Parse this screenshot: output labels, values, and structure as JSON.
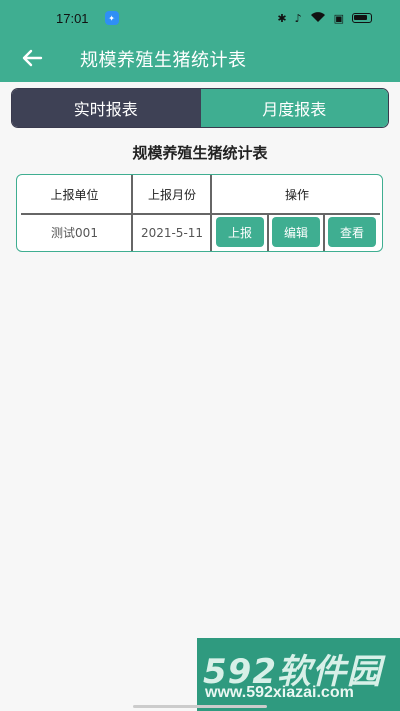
{
  "status_bar": {
    "time": "17:01",
    "icons": [
      "bluetooth-icon",
      "mute-icon",
      "wifi-icon",
      "battery-icon"
    ]
  },
  "app_bar": {
    "back_icon": "arrow-left-icon",
    "title": "规模养殖生猪统计表"
  },
  "tabs": [
    {
      "label": "实时报表",
      "active": false
    },
    {
      "label": "月度报表",
      "active": true
    }
  ],
  "table": {
    "title": "规模养殖生猪统计表",
    "headers": [
      "上报单位",
      "上报月份",
      "操作"
    ],
    "rows": [
      {
        "unit": "测试001",
        "month": "2021-5-11",
        "actions": [
          "上报",
          "编辑",
          "查看"
        ]
      }
    ]
  },
  "colors": {
    "primary": "#3fae91",
    "tab_inactive": "#3e4155",
    "background": "#f7f7f7"
  },
  "watermark": {
    "logo": "592软件园",
    "url": "www.592xiazai.com"
  }
}
